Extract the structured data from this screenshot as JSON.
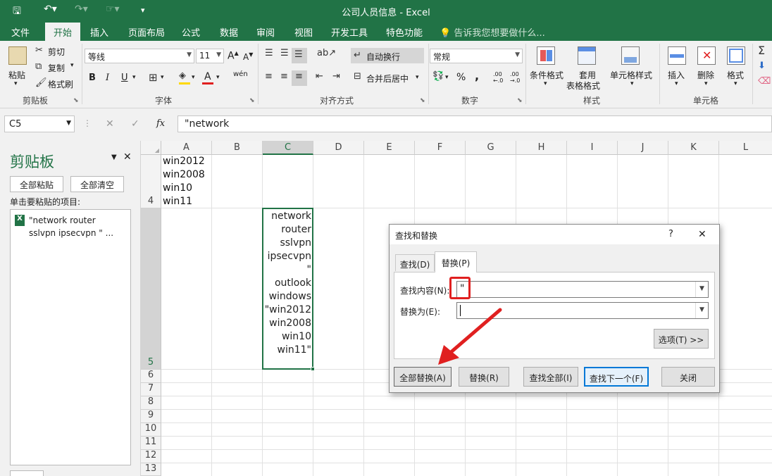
{
  "window": {
    "title": "公司人员信息 - Excel"
  },
  "tabs": [
    "文件",
    "开始",
    "插入",
    "页面布局",
    "公式",
    "数据",
    "审阅",
    "视图",
    "开发工具",
    "特色功能"
  ],
  "active_tab": "开始",
  "tellme": "告诉我您想要做什么...",
  "ribbon": {
    "clipboard": {
      "paste": "粘贴",
      "cut": "剪切",
      "copy": "复制",
      "format_painter": "格式刷",
      "label": "剪贴板"
    },
    "font": {
      "name": "等线",
      "size": "11",
      "bold": "B",
      "italic": "I",
      "underline": "U",
      "grow": "A",
      "shrink": "A",
      "phonetic": "wén",
      "label": "字体"
    },
    "alignment": {
      "wrap": "自动换行",
      "merge": "合并后居中",
      "label": "对齐方式"
    },
    "number": {
      "format": "常规",
      "percent": "%",
      "comma": ",",
      "inc_decimal": ".00 ←.0",
      "dec_decimal": ".00 →.0",
      "label": "数字"
    },
    "styles": {
      "conditional": "条件格式",
      "table_line1": "套用",
      "table_line2": "表格格式",
      "cell_styles": "单元格样式",
      "label": "样式"
    },
    "cells": {
      "insert": "插入",
      "delete": "删除",
      "format": "格式",
      "label": "单元格"
    }
  },
  "formula_bar": {
    "name_box": "C5",
    "cancel": "✕",
    "enter": "✓",
    "fx": "fx",
    "content": "\"network"
  },
  "clipboard_pane": {
    "title": "剪贴板",
    "paste_all": "全部粘贴",
    "clear_all": "全部清空",
    "instruction": "单击要粘贴的项目:",
    "item_line1": "\"network router",
    "item_line2": "sslvpn ipsecvpn \" ..."
  },
  "sheet": {
    "columns": [
      "A",
      "B",
      "C",
      "D",
      "E",
      "F",
      "G",
      "H",
      "I",
      "J",
      "K",
      "L"
    ],
    "rows": [
      "4",
      "5",
      "6",
      "7",
      "8",
      "9",
      "10",
      "11",
      "12",
      "13"
    ],
    "a4_lines": [
      "win2012",
      "win2008",
      "win10",
      "win11"
    ],
    "c5_lines": [
      "network",
      "router",
      "sslvpn",
      "ipsecvpn",
      "\"",
      "outlook",
      "windows",
      "\"win2012",
      "win2008",
      "win10",
      "win11\""
    ]
  },
  "dialog": {
    "title": "查找和替换",
    "help": "?",
    "close_x": "✕",
    "tab_find": "查找(D)",
    "tab_replace": "替换(P)",
    "find_label": "查找内容(N):",
    "find_value": "\"",
    "replace_label": "替换为(E):",
    "replace_value": "",
    "options": "选项(T) >>",
    "replace_all": "全部替换(A)",
    "replace": "替换(R)",
    "find_all": "查找全部(I)",
    "find_next": "查找下一个(F)",
    "close": "关闭"
  },
  "colors": {
    "excel_green": "#217346",
    "highlight_red": "#e02020"
  }
}
